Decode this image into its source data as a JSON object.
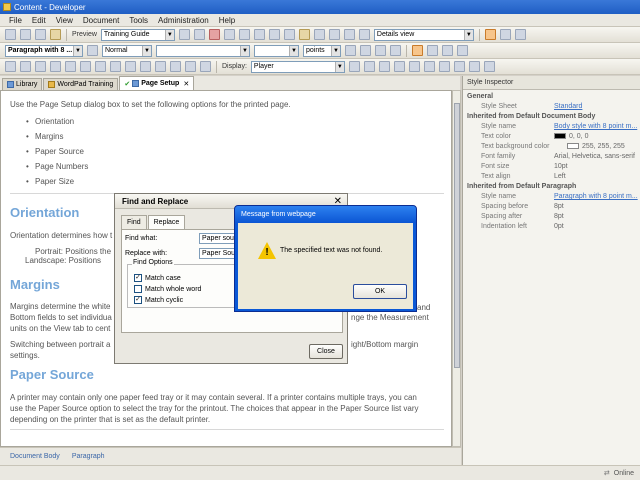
{
  "window": {
    "title": "Content - Developer"
  },
  "menu": [
    "File",
    "Edit",
    "View",
    "Document",
    "Tools",
    "Administration",
    "Help"
  ],
  "toolbar1": {
    "preview_label": "Preview",
    "guide_select": "Training Guide",
    "view_select": "Details view"
  },
  "toolbar2": {
    "style_select": "Paragraph with 8 ...",
    "font_select": "Normal",
    "size_unit": "points"
  },
  "toolbar3": {
    "display_label": "Display:",
    "display_select": "Player"
  },
  "tabs": [
    {
      "label": "Library"
    },
    {
      "label": "WordPad Training"
    },
    {
      "label": "Page Setup"
    }
  ],
  "document": {
    "intro": "Use the Page Setup dialog box to set the following options for the printed page.",
    "bullets": [
      "Orientation",
      "Margins",
      "Paper Source",
      "Page Numbers",
      "Paper Size"
    ],
    "h_orientation": "Orientation",
    "orientation_text": "Orientation determines how t",
    "portrait": "Portrait: Positions the",
    "landscape": "Landscape: Positions",
    "h_margins": "Margins",
    "margins_text1": "Margins determine the white",
    "margins_text2": "Bottom fields to set individua",
    "margins_text3": "units on the View tab to cent",
    "margins_tail1": "and",
    "margins_tail2": "nge the Measurement",
    "switching_text": "Switching between portrait a",
    "switching_tail": "ight/Bottom margin",
    "settings": "settings.",
    "h_paper_source": "Paper Source",
    "paper_text1": "A printer may contain only one paper feed tray or it may contain several. If a printer contains multiple trays, you can",
    "paper_text2": "use the Paper Source option to select the tray for the printout. The choices that appear in the Paper Source list vary",
    "paper_text3": "depending on the printer that is set as the default printer."
  },
  "bottom_crumbs": [
    "Document Body",
    "Paragraph"
  ],
  "status": {
    "online": "Online"
  },
  "inspector": {
    "title": "Style Inspector",
    "general": "General",
    "style_sheet_label": "Style Sheet",
    "style_sheet_value": "Standard",
    "inherited_body": "Inherited from Default Document Body",
    "style_name_label": "Style name",
    "style_name_value": "Body style with 8 point m...",
    "text_color_label": "Text color",
    "text_color_value": "0, 0, 0",
    "text_bg_label": "Text background color",
    "text_bg_value": "255, 255, 255",
    "font_family_label": "Font family",
    "font_family_value": "Arial, Helvetica, sans-serif",
    "font_size_label": "Font size",
    "font_size_value": "10pt",
    "text_align_label": "Text align",
    "text_align_value": "Left",
    "inherited_para": "Inherited from Default Paragraph",
    "style_name2_label": "Style name",
    "style_name2_value": "Paragraph with 8 point m...",
    "spacing_before_label": "Spacing before",
    "spacing_before_value": "8pt",
    "spacing_after_label": "Spacing after",
    "spacing_after_value": "8pt",
    "indentation_left_label": "Indentation left",
    "indentation_left_value": "0pt"
  },
  "find_replace": {
    "title": "Find and Replace",
    "tab_find": "Find",
    "tab_replace": "Replace",
    "find_what_label": "Find what:",
    "find_what_value": "Paper sou",
    "replace_with_label": "Replace with:",
    "replace_with_value": "Paper Sou",
    "options_legend": "Find Options",
    "opt_match_case": "Match case",
    "opt_match_whole": "Match whole word",
    "opt_match_cyclic": "Match cyclic",
    "close_label": "Close"
  },
  "message": {
    "title": "Message from webpage",
    "text": "The specified text was not found.",
    "ok_label": "OK"
  }
}
